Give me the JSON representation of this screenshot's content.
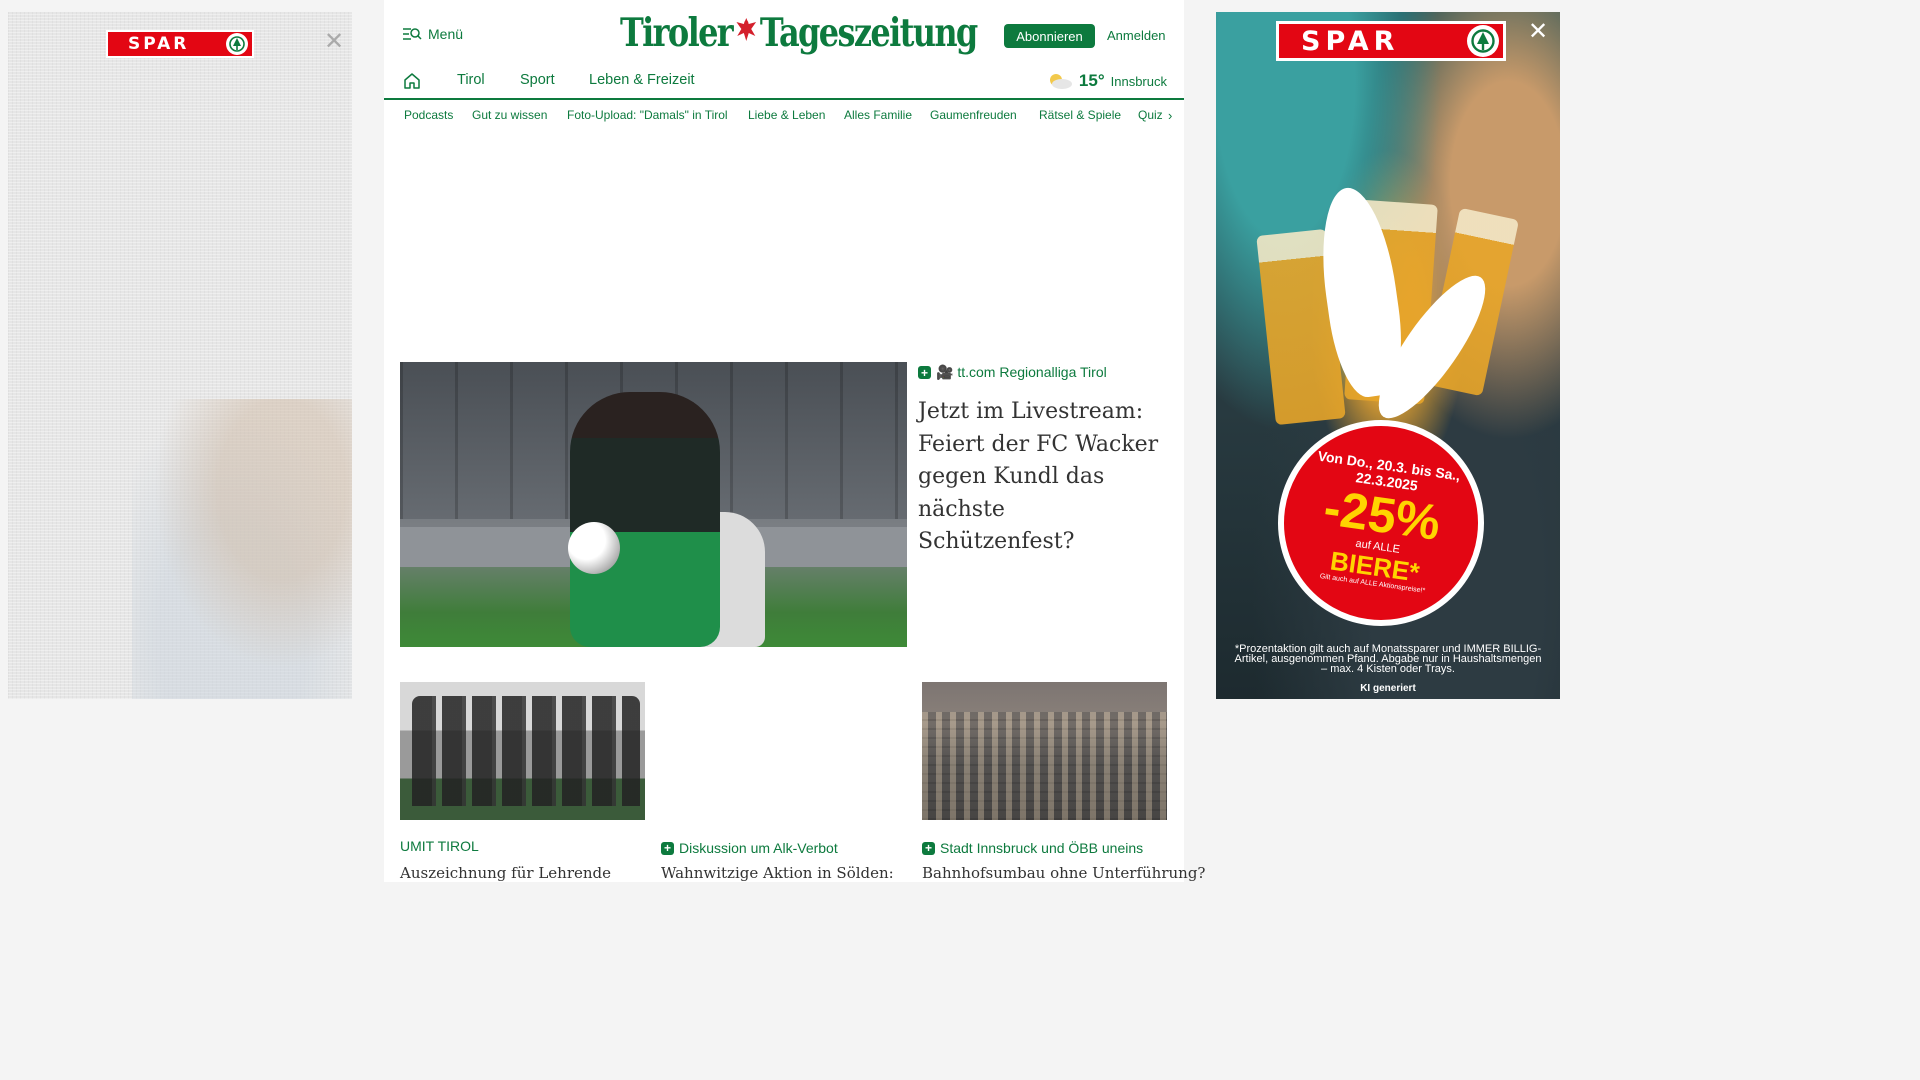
{
  "ads": {
    "left": {
      "brand": "SPAR",
      "close_symbol": "✕"
    },
    "right": {
      "brand": "SPAR",
      "close_symbol": "✕",
      "dates": "Von Do., 20.3. bis Sa., 22.3.2025",
      "discount": "-25%",
      "auf": "auf ALLE",
      "product": "BIERE*",
      "small_note": "Gilt auch auf ALLE Aktionspreise!*",
      "fine_print": "*Prozentaktion gilt auch auf Monatssparer und IMMER BILLIG-Artikel, ausgenommen Pfand. Abgabe nur in Haushaltsmengen – max. 4 Kisten oder Trays.",
      "ai_note": "KI generiert"
    }
  },
  "header": {
    "menu_label": "Menü",
    "logo_left": "Tiroler",
    "logo_right": "Tageszeitung",
    "subscribe_label": "Abonnieren",
    "login_label": "Anmelden"
  },
  "nav": {
    "items": [
      "Tirol",
      "Sport",
      "Leben & Freizeit"
    ],
    "weather": {
      "temp": "15°",
      "city": "Innsbruck"
    },
    "sub_items": [
      "Podcasts",
      "Gut zu wissen",
      "Foto-Upload: \"Damals\" in Tirol",
      "Liebe & Leben",
      "Alles Familie",
      "Gaumenfreuden",
      "Rätsel & Spiele",
      "Quiz"
    ]
  },
  "hero": {
    "kicker": "🎥 tt.com Regionalliga Tirol",
    "headline": "Jetzt im Livestream: Feiert der FC Wacker gegen Kundl das nächste Schützenfest?"
  },
  "teasers": [
    {
      "kicker": "UMIT TIROL",
      "headline": "Auszeichnung für Lehrende"
    },
    {
      "kicker": "Diskussion um Alk-Verbot",
      "headline": "Wahnwitzige Aktion in Sölden:"
    },
    {
      "kicker": "Stadt Innsbruck und ÖBB uneins",
      "headline": "Bahnhofsumbau ohne Unterführung?"
    }
  ],
  "colors": {
    "brand_green": "#0d7a3e",
    "spar_red": "#e30613",
    "eagle_red": "#d4202c",
    "promo_yellow": "#ffd400"
  }
}
